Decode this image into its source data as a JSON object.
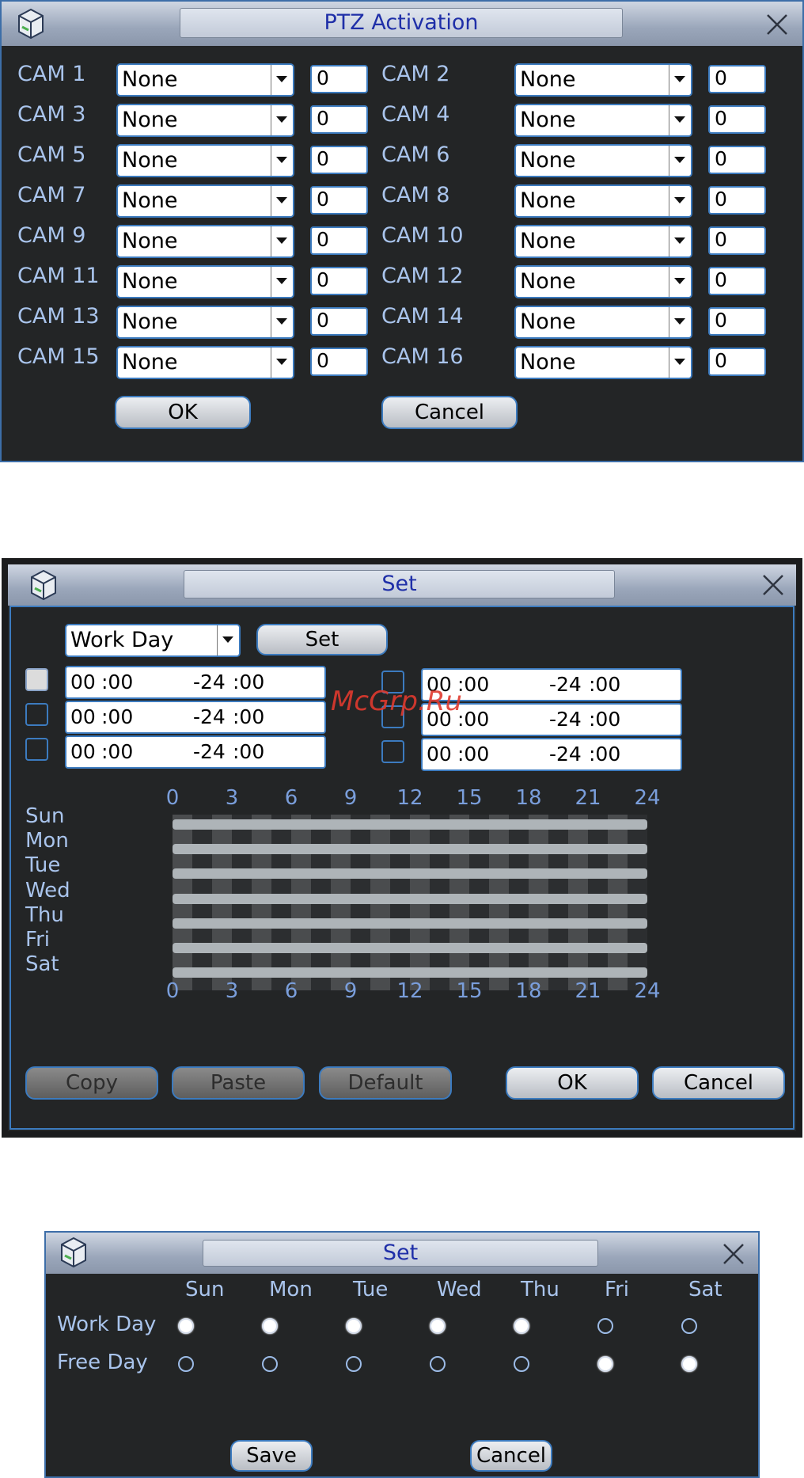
{
  "ptz_dialog": {
    "title": "PTZ Activation",
    "rows": [
      {
        "left": {
          "cam": "CAM 1",
          "preset": "None",
          "value": "0"
        },
        "right": {
          "cam": "CAM 2",
          "preset": "None",
          "value": "0"
        }
      },
      {
        "left": {
          "cam": "CAM 3",
          "preset": "None",
          "value": "0"
        },
        "right": {
          "cam": "CAM 4",
          "preset": "None",
          "value": "0"
        }
      },
      {
        "left": {
          "cam": "CAM 5",
          "preset": "None",
          "value": "0"
        },
        "right": {
          "cam": "CAM 6",
          "preset": "None",
          "value": "0"
        }
      },
      {
        "left": {
          "cam": "CAM 7",
          "preset": "None",
          "value": "0"
        },
        "right": {
          "cam": "CAM 8",
          "preset": "None",
          "value": "0"
        }
      },
      {
        "left": {
          "cam": "CAM 9",
          "preset": "None",
          "value": "0"
        },
        "right": {
          "cam": "CAM 10",
          "preset": "None",
          "value": "0"
        }
      },
      {
        "left": {
          "cam": "CAM 11",
          "preset": "None",
          "value": "0"
        },
        "right": {
          "cam": "CAM 12",
          "preset": "None",
          "value": "0"
        }
      },
      {
        "left": {
          "cam": "CAM 13",
          "preset": "None",
          "value": "0"
        },
        "right": {
          "cam": "CAM 14",
          "preset": "None",
          "value": "0"
        }
      },
      {
        "left": {
          "cam": "CAM 15",
          "preset": "None",
          "value": "0"
        },
        "right": {
          "cam": "CAM 16",
          "preset": "None",
          "value": "0"
        }
      }
    ],
    "ok_label": "OK",
    "cancel_label": "Cancel"
  },
  "set_dialog": {
    "title": "Set",
    "day_select": "Work Day",
    "set_label": "Set",
    "periods": [
      {
        "start_h": "00",
        "start_m": ":00",
        "end_h": "-24",
        "end_m": ":00",
        "checked": true
      },
      {
        "start_h": "00",
        "start_m": ":00",
        "end_h": "-24",
        "end_m": ":00",
        "checked": false
      },
      {
        "start_h": "00",
        "start_m": ":00",
        "end_h": "-24",
        "end_m": ":00",
        "checked": false
      },
      {
        "start_h": "00",
        "start_m": ":00",
        "end_h": "-24",
        "end_m": ":00",
        "checked": false
      },
      {
        "start_h": "00",
        "start_m": ":00",
        "end_h": "-24",
        "end_m": ":00",
        "checked": false
      },
      {
        "start_h": "00",
        "start_m": ":00",
        "end_h": "-24",
        "end_m": ":00",
        "checked": false
      }
    ],
    "hour_ticks": [
      "0",
      "3",
      "6",
      "9",
      "12",
      "15",
      "18",
      "21",
      "24"
    ],
    "days": [
      "Sun",
      "Mon",
      "Tue",
      "Wed",
      "Thu",
      "Fri",
      "Sat"
    ],
    "schedule_bars": [
      {
        "day": "Sun",
        "from": 0,
        "to": 24
      },
      {
        "day": "Mon",
        "from": 0,
        "to": 24
      },
      {
        "day": "Tue",
        "from": 0,
        "to": 24
      },
      {
        "day": "Wed",
        "from": 0,
        "to": 24
      },
      {
        "day": "Thu",
        "from": 0,
        "to": 24
      },
      {
        "day": "Fri",
        "from": 0,
        "to": 24
      },
      {
        "day": "Sat",
        "from": 0,
        "to": 24
      }
    ],
    "copy_label": "Copy",
    "paste_label": "Paste",
    "default_label": "Default",
    "ok_label": "OK",
    "cancel_label": "Cancel"
  },
  "watermark": "McGrp.Ru",
  "day_type_dialog": {
    "title": "Set",
    "days": [
      "Sun",
      "Mon",
      "Tue",
      "Wed",
      "Thu",
      "Fri",
      "Sat"
    ],
    "work_day_label": "Work Day",
    "free_day_label": "Free Day",
    "work_day_selected": [
      true,
      true,
      true,
      true,
      true,
      false,
      false
    ],
    "free_day_selected": [
      false,
      false,
      false,
      false,
      false,
      true,
      true
    ],
    "save_label": "Save",
    "cancel_label": "Cancel"
  },
  "colors": {
    "dialog_bg": "#232526",
    "border_blue": "#3c7bbf",
    "label_blue": "#a9c4ec",
    "title_text": "#1f2fa8",
    "schedule_bar": "#aeb4b8",
    "watermark": "#e03a2e"
  }
}
